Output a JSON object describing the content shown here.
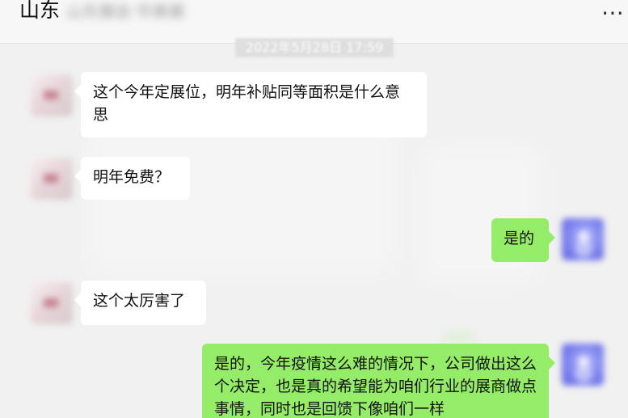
{
  "header": {
    "title": "山东",
    "subtitle_blurred": "山东展会·华美展",
    "more_icon": "more-dots-icon"
  },
  "chat": {
    "timestamp": "2022年5月28日 17:59",
    "messages": [
      {
        "side": "left",
        "text": "这个今年定展位，明年补贴同等面积是什么意思"
      },
      {
        "side": "left",
        "text": "明年免费？"
      },
      {
        "side": "right",
        "text": "是的"
      },
      {
        "side": "left",
        "text": "这个太厉害了"
      },
      {
        "side": "right",
        "text": "是的，今年疫情这么难的情况下，公司做出这么个决定，也是真的希望能为咱们行业的展商做点事情，同时也是回馈下像咱们一样"
      }
    ]
  },
  "colors": {
    "background": "#f1f1f1",
    "left_bubble": "#ffffff",
    "right_bubble": "#95ec69",
    "text": "#111111"
  }
}
